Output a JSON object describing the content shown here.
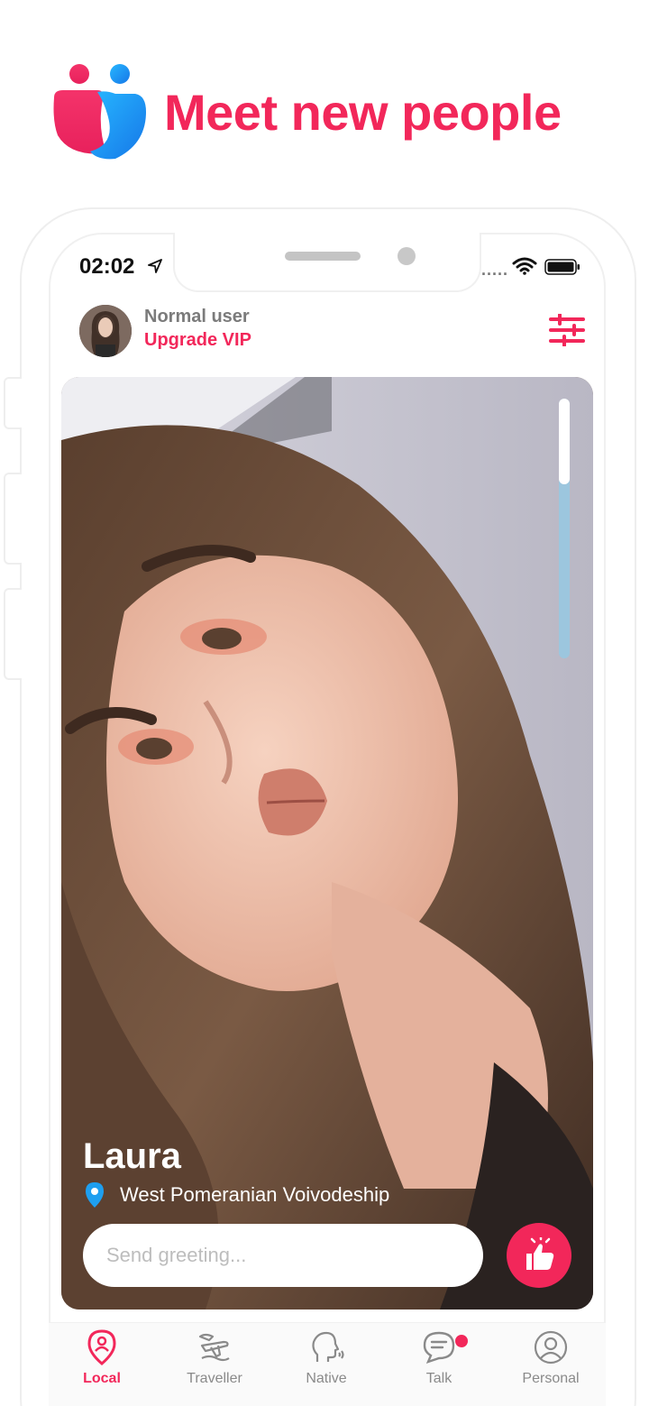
{
  "promo": {
    "headline": "Meet new people"
  },
  "status_bar": {
    "time": "02:02",
    "signal": "....."
  },
  "header": {
    "user_status": "Normal user",
    "upgrade_link": "Upgrade VIP"
  },
  "profile_card": {
    "name": "Laura",
    "location": "West Pomeranian Voivodeship",
    "photo_progress": 0.33,
    "greeting_placeholder": "Send greeting..."
  },
  "tabs": [
    {
      "label": "Local",
      "icon": "location-person-icon",
      "active": true
    },
    {
      "label": "Traveller",
      "icon": "plane-icon",
      "active": false
    },
    {
      "label": "Native",
      "icon": "head-speaking-icon",
      "active": false
    },
    {
      "label": "Talk",
      "icon": "chat-bubble-icon",
      "active": false,
      "badge": true
    },
    {
      "label": "Personal",
      "icon": "person-circle-icon",
      "active": false
    }
  ],
  "colors": {
    "accent": "#f2275a",
    "brand_blue": "#1e9ff0",
    "progress_track": "#9cc6de"
  }
}
